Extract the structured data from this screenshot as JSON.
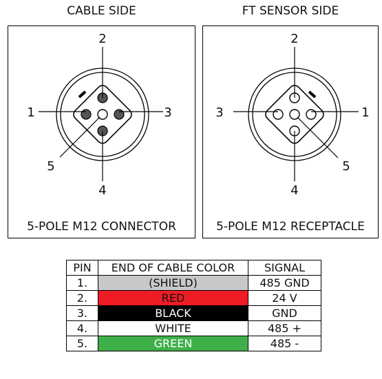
{
  "headers": {
    "cable_side": "CABLE SIDE",
    "sensor_side": "FT SENSOR SIDE"
  },
  "connector": {
    "label": "5-POLE M12 CONNECTOR",
    "pin_labels": {
      "top": "2",
      "left": "1",
      "right": "3",
      "bottom": "4",
      "lower_left": "5"
    }
  },
  "receptacle": {
    "label": "5-POLE M12 RECEPTACLE",
    "pin_labels": {
      "top": "2",
      "left": "3",
      "right": "1",
      "bottom": "4",
      "lower_right": "5"
    }
  },
  "table": {
    "headers": {
      "pin": "PIN",
      "color": "END OF CABLE COLOR",
      "signal": "SIGNAL"
    },
    "rows": [
      {
        "pin": "1.",
        "color": "(SHIELD)",
        "signal": "485 GND",
        "bg": "#c8c8c8",
        "fg": "#111111"
      },
      {
        "pin": "2.",
        "color": "RED",
        "signal": "24 V",
        "bg": "#ee1c24",
        "fg": "#111111"
      },
      {
        "pin": "3.",
        "color": "BLACK",
        "signal": "GND",
        "bg": "#000000",
        "fg": "#ffffff"
      },
      {
        "pin": "4.",
        "color": "WHITE",
        "signal": "485 +",
        "bg": "#ffffff",
        "fg": "#111111"
      },
      {
        "pin": "5.",
        "color": "GREEN",
        "signal": "485 -",
        "bg": "#3fb049",
        "fg": "#ffffff"
      }
    ]
  }
}
